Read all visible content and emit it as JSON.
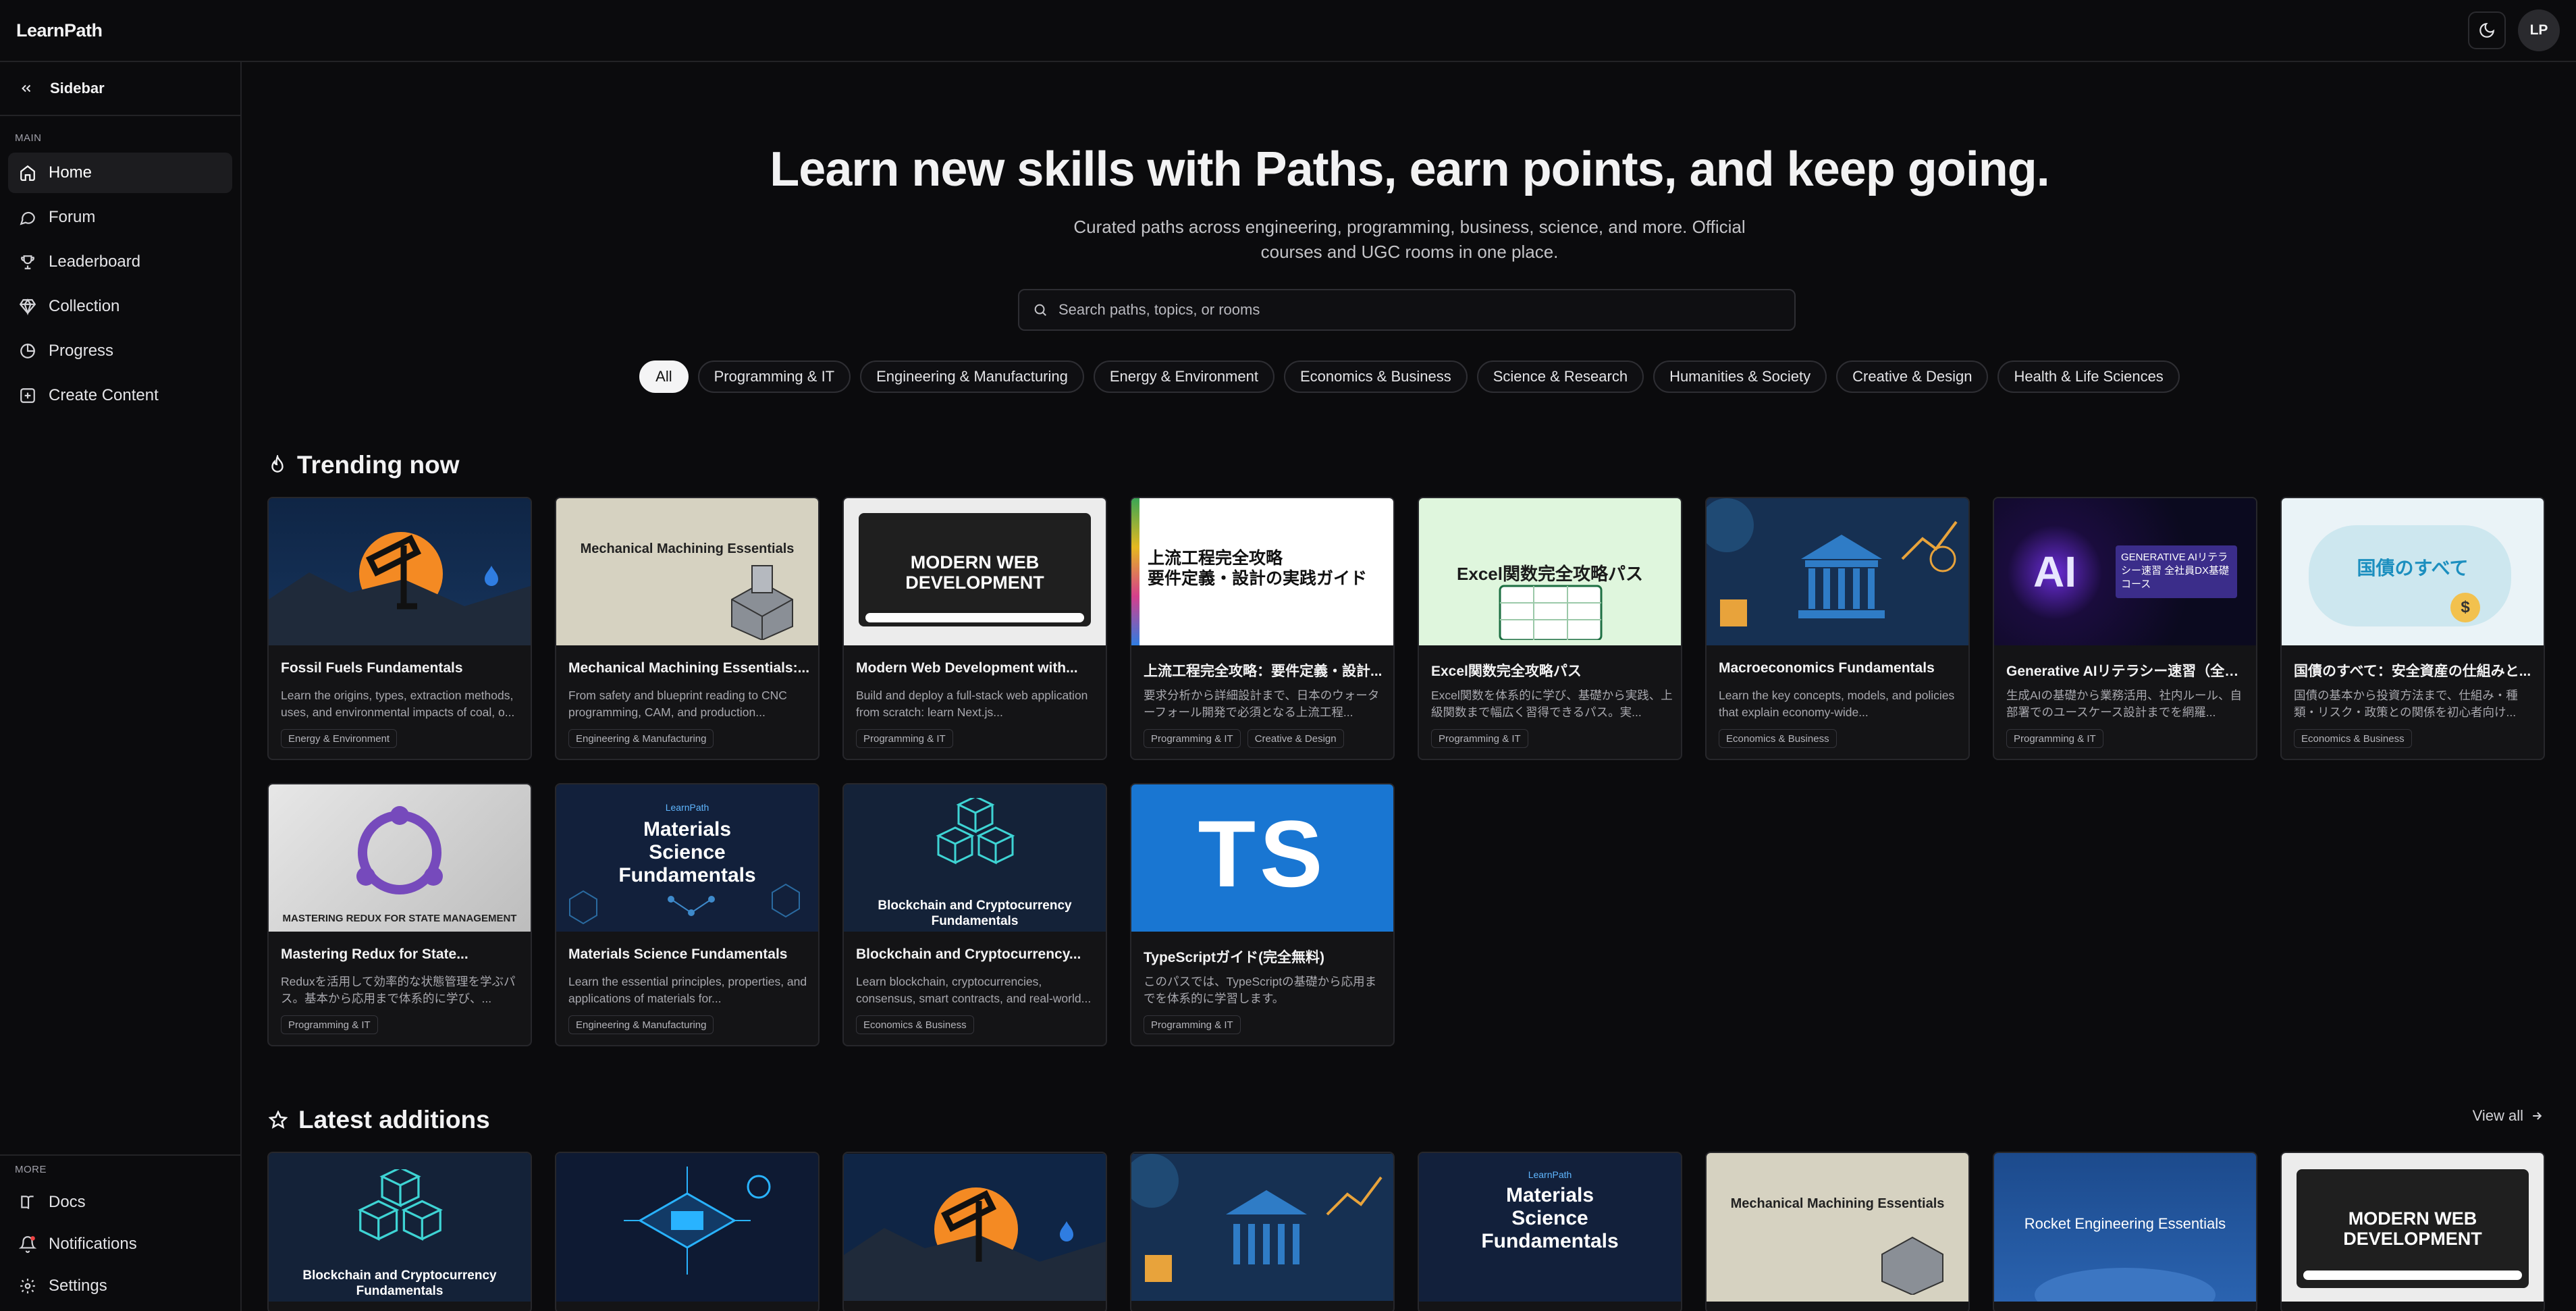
{
  "app": {
    "brand": "LearnPath",
    "avatar_initials": "LP"
  },
  "sidebar": {
    "toggle_label": "Sidebar",
    "main_section": "MAIN",
    "items": [
      {
        "label": "Home",
        "icon": "home-icon",
        "active": true
      },
      {
        "label": "Forum",
        "icon": "chat-icon"
      },
      {
        "label": "Leaderboard",
        "icon": "trophy-icon"
      },
      {
        "label": "Collection",
        "icon": "gem-icon"
      },
      {
        "label": "Progress",
        "icon": "progress-icon"
      },
      {
        "label": "Create Content",
        "icon": "create-icon"
      }
    ],
    "more_section": "MORE",
    "more_items": [
      {
        "label": "Docs",
        "icon": "docs-icon"
      },
      {
        "label": "Notifications",
        "icon": "bell-icon"
      },
      {
        "label": "Settings",
        "icon": "gear-icon"
      }
    ]
  },
  "hero": {
    "title": "Learn new skills with Paths, earn points, and keep going.",
    "subtitle": "Curated paths across engineering, programming, business, science, and more. Official courses and UGC rooms in one place.",
    "search_placeholder": "Search paths, topics, or rooms"
  },
  "categories": [
    "All",
    "Programming & IT",
    "Engineering & Manufacturing",
    "Energy & Environment",
    "Economics & Business",
    "Science & Research",
    "Humanities & Society",
    "Creative & Design",
    "Health & Life Sciences"
  ],
  "trending": {
    "title": "Trending now",
    "cards": [
      {
        "title": "Fossil Fuels Fundamentals",
        "desc": "Learn the origins, types, extraction methods, uses, and environmental impacts of coal, o...",
        "tags": [
          "Energy & Environment"
        ]
      },
      {
        "title": "Mechanical Machining Essentials:...",
        "desc": "From safety and blueprint reading to CNC programming, CAM, and production...",
        "tags": [
          "Engineering & Manufacturing"
        ],
        "thumb_text": "Mechanical Machining Essentials"
      },
      {
        "title": "Modern Web Development with...",
        "desc": "Build and deploy a full-stack web application from scratch: learn Next.js...",
        "tags": [
          "Programming & IT"
        ],
        "thumb_text": "MODERN WEB DEVELOPMENT"
      },
      {
        "title": "上流工程完全攻略：要件定義・設計...",
        "desc": "要求分析から詳細設計まで、日本のウォーターフォール開発で必須となる上流工程...",
        "tags": [
          "Programming & IT",
          "Creative & Design"
        ],
        "thumb_text": "上流工程完全攻略\n要件定義・設計の実践ガイド"
      },
      {
        "title": "Excel関数完全攻略パス",
        "desc": "Excel関数を体系的に学び、基礎から実践、上級関数まで幅広く習得できるパス。実...",
        "tags": [
          "Programming & IT"
        ],
        "thumb_text": "Excel関数完全攻略パス"
      },
      {
        "title": "Macroeconomics Fundamentals",
        "desc": "Learn the key concepts, models, and policies that explain economy-wide...",
        "tags": [
          "Economics & Business"
        ]
      },
      {
        "title": "Generative AIリテラシー速習（全社...",
        "desc": "生成AIの基礎から業務活用、社内ルール、自部署でのユースケース設計までを網羅...",
        "tags": [
          "Programming & IT"
        ],
        "thumb_text": "GENERATIVE AIリテラシー速習 全社員DX基礎コース"
      },
      {
        "title": "国債のすべて：安全資産の仕組みと...",
        "desc": "国債の基本から投資方法まで、仕組み・種類・リスク・政策との関係を初心者向け...",
        "tags": [
          "Economics & Business"
        ],
        "thumb_text": "国債のすべて"
      },
      {
        "title": "Mastering Redux for State...",
        "desc": "Reduxを活用して効率的な状態管理を学ぶパス。基本から応用まで体系的に学び、...",
        "tags": [
          "Programming & IT"
        ],
        "thumb_text": "MASTERING REDUX FOR STATE MANAGEMENT"
      },
      {
        "title": "Materials Science Fundamentals",
        "desc": "Learn the essential principles, properties, and applications of materials for...",
        "tags": [
          "Engineering & Manufacturing"
        ],
        "thumb_text": "Materials Science Fundamentals",
        "thumb_brand": "LearnPath"
      },
      {
        "title": "Blockchain and Cryptocurrency...",
        "desc": "Learn blockchain, cryptocurrencies, consensus, smart contracts, and real-world...",
        "tags": [
          "Economics & Business"
        ],
        "thumb_text": "Blockchain and Cryptocurrency Fundamentals"
      },
      {
        "title": "TypeScriptガイド(完全無料)",
        "desc": "このパスでは、TypeScriptの基礎から応用までを体系的に学習します。",
        "tags": [
          "Programming & IT"
        ],
        "thumb_text": "TS"
      }
    ]
  },
  "latest": {
    "title": "Latest additions",
    "view_all": "View all",
    "thumbs": [
      "Blockchain and Cryptocurrency Fundamentals",
      "",
      "",
      "",
      "Materials Science Fundamentals",
      "Mechanical Machining Essentials",
      "Rocket Engineering Essentials",
      "MODERN WEB DEVELOPMENT"
    ],
    "thumb_brand": "LearnPath"
  },
  "colors": {
    "background": "#0b0b0d",
    "card": "#141416",
    "accent_ts": "#1976d2",
    "redux": "#764abc"
  }
}
